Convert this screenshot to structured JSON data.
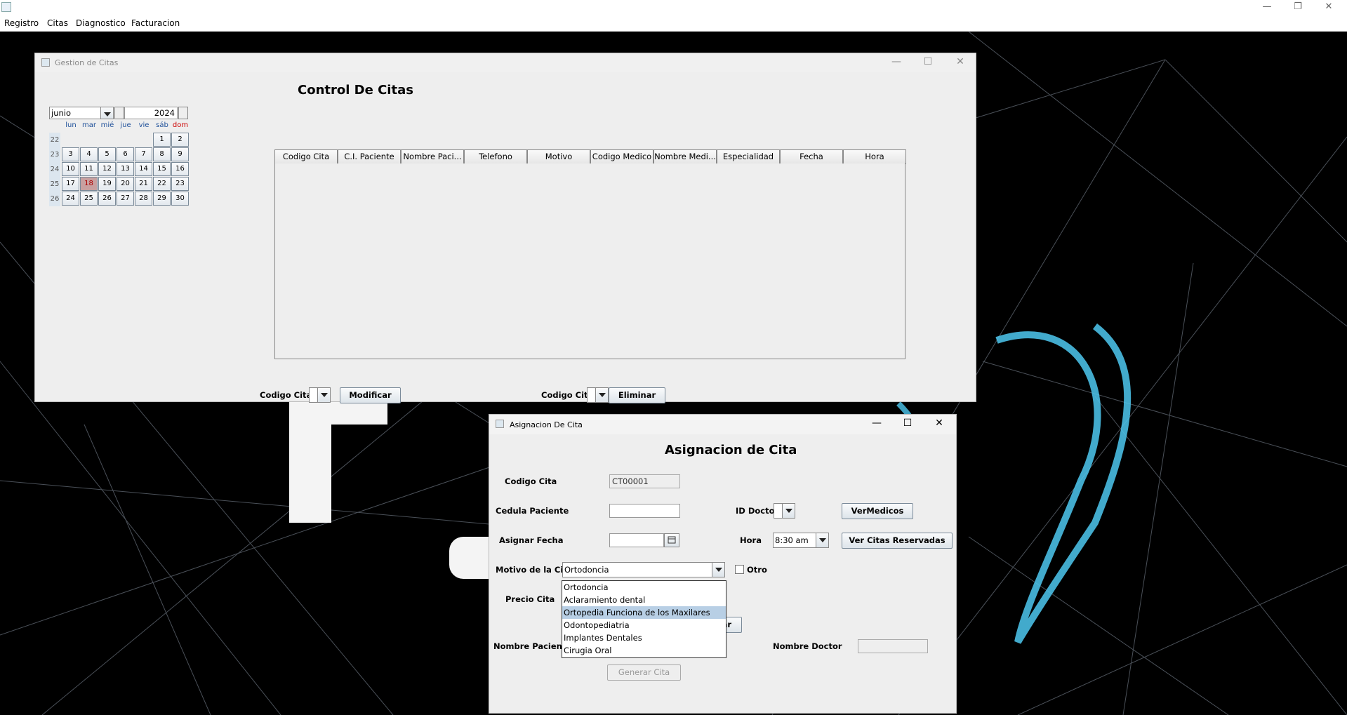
{
  "menu": {
    "items": [
      "Registro",
      "Citas",
      "Diagnostico",
      "Facturacion"
    ]
  },
  "app": {
    "min": "—",
    "max": "❐",
    "close": "✕"
  },
  "gestion": {
    "title": "Gestion de Citas",
    "heading": "Control De Citas",
    "calendar": {
      "month": "junio",
      "year": "2024",
      "day_headers": [
        "lun",
        "mar",
        "mié",
        "jue",
        "vie",
        "sáb",
        "dom"
      ],
      "week_numbers": [
        "22",
        "23",
        "24",
        "25",
        "26"
      ],
      "weeks": [
        [
          "",
          "",
          "",
          "",
          "",
          "1",
          "2"
        ],
        [
          "3",
          "4",
          "5",
          "6",
          "7",
          "8",
          "9"
        ],
        [
          "10",
          "11",
          "12",
          "13",
          "14",
          "15",
          "16"
        ],
        [
          "17",
          "18",
          "19",
          "20",
          "21",
          "22",
          "23"
        ],
        [
          "24",
          "25",
          "26",
          "27",
          "28",
          "29",
          "30"
        ]
      ],
      "selected_day": "18"
    },
    "table": {
      "columns": [
        "Codigo Cita",
        "C.I. Paciente",
        "Nombre Paci...",
        "Telefono",
        "Motivo",
        "Codigo Medico",
        "Nombre Medi...",
        "Especialidad",
        "Fecha",
        "Hora"
      ],
      "rows": []
    },
    "modify": {
      "label": "Codigo Cita:",
      "button": "Modificar"
    },
    "delete": {
      "label": "Codigo Cita",
      "button": "Eliminar"
    }
  },
  "asignacion": {
    "title": "Asignacion De Cita",
    "heading": "Asignacion de Cita",
    "codigo_cita": {
      "label": "Codigo Cita",
      "value": "CT00001"
    },
    "cedula": {
      "label": "Cedula Paciente",
      "value": ""
    },
    "id_doctor": {
      "label": "ID Doctor",
      "value": ""
    },
    "ver_medicos": "VerMedicos",
    "asignar_fecha": {
      "label": "Asignar Fecha",
      "value": ""
    },
    "hora": {
      "label": "Hora",
      "value": "8:30 am"
    },
    "ver_citas": "Ver Citas Reservadas",
    "motivo": {
      "label": "Motivo de la Cita",
      "value": "Ortodoncia",
      "options": [
        "Ortodoncia",
        "Aclaramiento dental",
        "Ortopedia Funciona de los Maxilares",
        "Odontopediatria",
        "Implantes Dentales",
        "Cirugia Oral"
      ],
      "highlighted": "Ortopedia Funciona de los Maxilares"
    },
    "otro": "Otro",
    "precio": {
      "label": "Precio Cita"
    },
    "buscar_partial": "car",
    "nombre_paciente": {
      "label": "Nombre Paciente"
    },
    "nombre_doctor": {
      "label": "Nombre Doctor",
      "value": ""
    },
    "generar": "Generar Cita"
  },
  "colors": {
    "desktop": "#000000",
    "frame": "#eeeeee",
    "highlight": "#b8cfe5",
    "selected_day": "#c8a0a0",
    "accent_glow": "#4ec8f0"
  }
}
